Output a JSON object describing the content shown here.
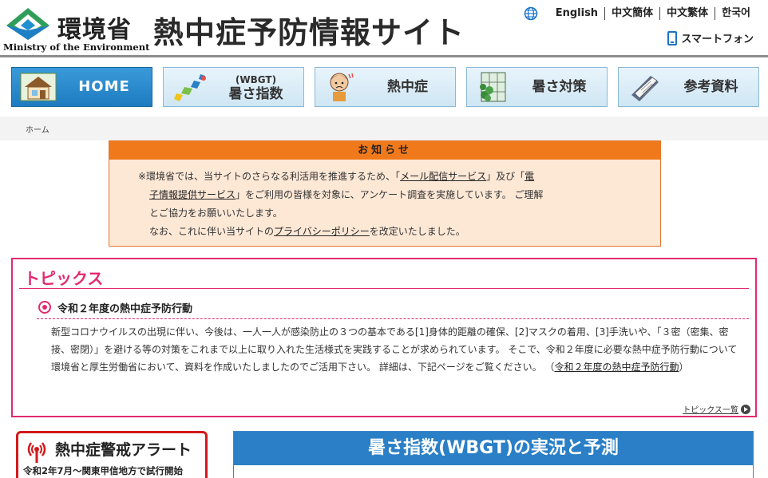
{
  "header": {
    "ministry_jp": "環境省",
    "ministry_en": "Ministry of the Environment",
    "site_title": "熱中症予防情報サイト",
    "languages": [
      "English",
      "中文簡体",
      "中文繁体",
      "한국어"
    ],
    "smartphone": "スマートフォン"
  },
  "nav": {
    "items": [
      {
        "label": "HOME"
      },
      {
        "sub": "(WBGT)",
        "label": "暑さ指数"
      },
      {
        "label": "熱中症"
      },
      {
        "label": "暑さ対策"
      },
      {
        "label": "参考資料"
      }
    ]
  },
  "breadcrumb": {
    "home": "ホーム"
  },
  "notice": {
    "title": "お知らせ",
    "line1_a": "※環境省では、当サイトのさらなる利活用を推進するため、「",
    "link_mail": "メール配信サービス",
    "line1_b": "」及び「",
    "link_data_a": "電",
    "link_data_b": "子情報提供サービス",
    "line2_b": "」をご利用の皆様を対象に、アンケート調査を実施しています。 ご理解",
    "line3": "とご協力をお願いいたします。",
    "line4_a": "なお、これに伴い当サイトの",
    "link_privacy": "プライバシーポリシー",
    "line4_b": "を改定いたしました。"
  },
  "topics": {
    "title": "トピックス",
    "heading": "令和２年度の熱中症予防行動",
    "body": "新型コロナウイルスの出現に伴い、今後は、一人一人が感染防止の３つの基本である[1]身体的距離の確保、[2]マスクの着用、[3]手洗いや、「３密（密集、密接、密閉）」を避ける等の対策をこれまで以上に取り入れた生活様式を実践することが求められています。 そこで、令和２年度に必要な熱中症予防行動について環境省と厚生労働省において、資料を作成いたしましたのでご活用下さい。 詳細は、下記ページをご覧ください。 （",
    "body_link": "令和２年度の熱中症予防行動",
    "body_end": "）",
    "more": "トピックス一覧"
  },
  "alert": {
    "title": "熱中症警戒アラート",
    "sub": "令和2年7月～関東甲信地方で試行開始"
  },
  "wbgt": {
    "title": "暑さ指数(WBGT)の実況と予測"
  },
  "colors": {
    "nav_active": "#1d7cc1",
    "notice_header": "#f07a1b",
    "topics_accent": "#e3296f",
    "alert_border": "#d21a1a",
    "wbgt_header": "#2a7fc6"
  }
}
